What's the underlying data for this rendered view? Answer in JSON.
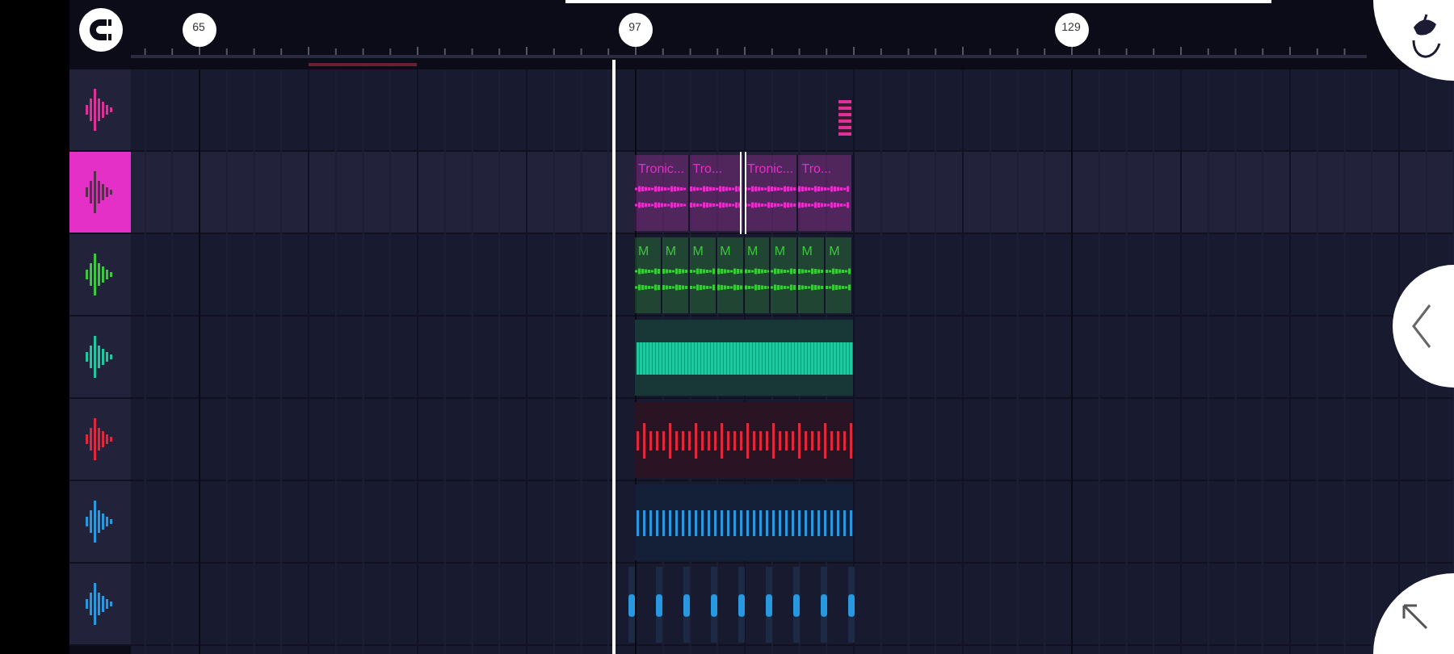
{
  "ruler": {
    "markers": [
      "65",
      "97",
      "129"
    ]
  },
  "tracks": [
    {
      "color": "#e0309a",
      "selected": false,
      "kind": "sparse"
    },
    {
      "color": "#e030c8",
      "selected": true,
      "kind": "named",
      "clips": [
        "Tronic...",
        "Tro...",
        "Tronic...",
        "Tro..."
      ]
    },
    {
      "color": "#3cc83c",
      "selected": false,
      "kind": "named",
      "clips": [
        "M",
        "M",
        "M",
        "M",
        "M",
        "M",
        "M",
        "M"
      ]
    },
    {
      "color": "#20c8a0",
      "selected": false,
      "kind": "dense"
    },
    {
      "color": "#e0283c",
      "selected": false,
      "kind": "pulse"
    },
    {
      "color": "#2898e0",
      "selected": false,
      "kind": "bars"
    },
    {
      "color": "#2898e0",
      "selected": false,
      "kind": "hits"
    }
  ]
}
